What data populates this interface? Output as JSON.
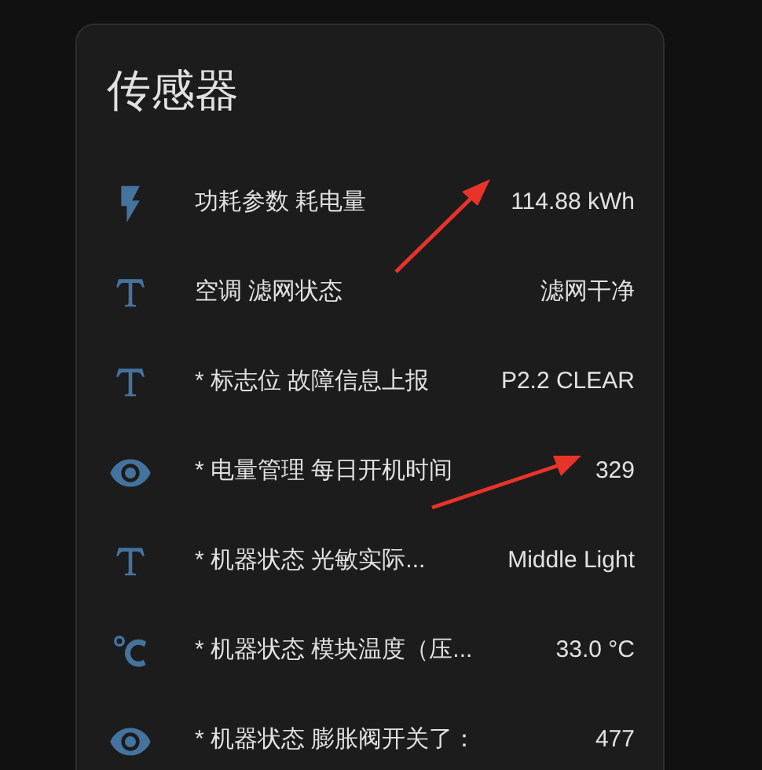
{
  "card": {
    "title": "传感器",
    "rows": [
      {
        "kind": "flash",
        "name": "功耗参数 耗电量",
        "value": "114.88 kWh"
      },
      {
        "kind": "text",
        "name": "空调 滤网状态",
        "value": "滤网干净"
      },
      {
        "kind": "text",
        "name": "* 标志位 故障信息上报",
        "value": "P2.2 CLEAR"
      },
      {
        "kind": "eye",
        "name": "* 电量管理 每日开机时间",
        "value": "329"
      },
      {
        "kind": "text",
        "name": "* 机器状态 光敏实际...",
        "value": "Middle Light"
      },
      {
        "kind": "celsius",
        "name": "* 机器状态 模块温度（压...",
        "value": "33.0 °C"
      },
      {
        "kind": "eye",
        "name": "* 机器状态 膨胀阀开关了：",
        "value": "477"
      }
    ]
  }
}
